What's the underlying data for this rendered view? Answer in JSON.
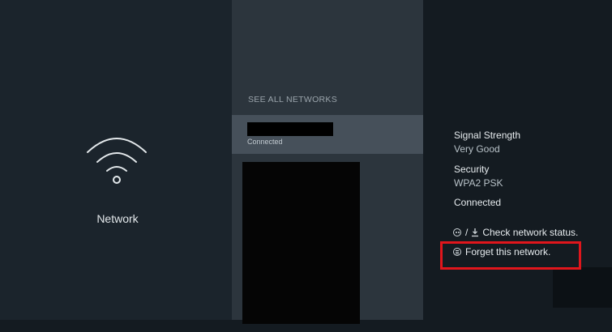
{
  "left": {
    "icon": "wifi-icon",
    "label": "Network"
  },
  "networks": {
    "heading": "SEE ALL NETWORKS",
    "selected": {
      "name": "",
      "status": "Connected"
    }
  },
  "details": {
    "signal_label": "Signal Strength",
    "signal_value": "Very Good",
    "security_label": "Security",
    "security_value": "WPA2 PSK",
    "connection_status": "Connected"
  },
  "hints": {
    "check_icons": [
      "play-pause-icon",
      "download-icon"
    ],
    "check_separator": "/",
    "check_text": "Check network status.",
    "forget_icon": "menu-button-icon",
    "forget_text": "Forget this network."
  },
  "colors": {
    "highlight": "#e0161c",
    "selected_row": "#46505a"
  }
}
